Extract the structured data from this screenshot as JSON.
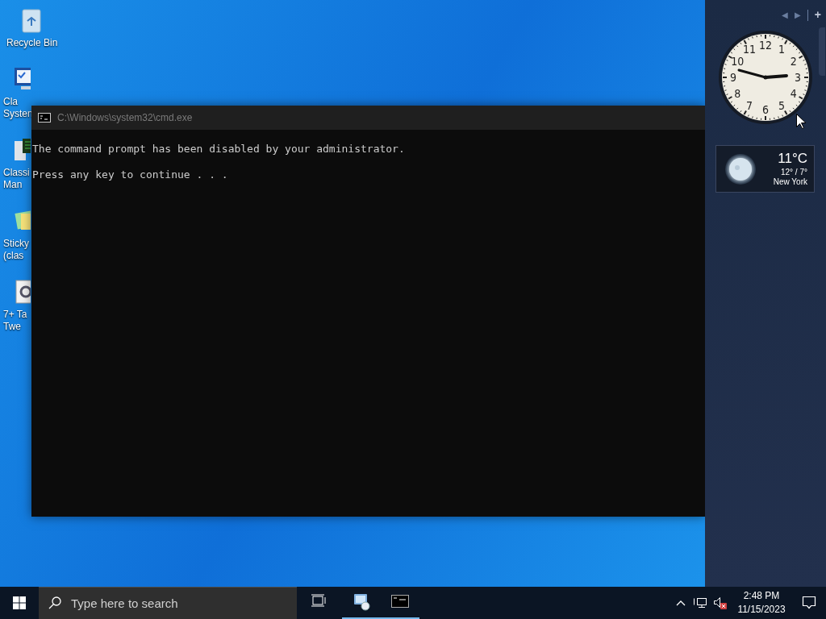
{
  "desktop_icons": [
    {
      "kind": "bin",
      "lines": [
        "Recycle Bin"
      ]
    },
    {
      "kind": "monitor",
      "lines": [
        "Cla",
        "Systen"
      ]
    },
    {
      "kind": "computer",
      "lines": [
        "Classi",
        "Man"
      ]
    },
    {
      "kind": "notes",
      "lines": [
        "Sticky",
        "(clas"
      ]
    },
    {
      "kind": "tweaker",
      "lines": [
        "7+ Ta",
        "Twe"
      ]
    }
  ],
  "console": {
    "title": "C:\\Windows\\system32\\cmd.exe",
    "lines": [
      "The command prompt has been disabled by your administrator.",
      "Press any key to continue . . ."
    ]
  },
  "gadgets": {
    "previous_label": "◀",
    "next_label": "▶",
    "add_label": "+",
    "clock": {
      "numerals": [
        "12",
        "11",
        "1",
        "10",
        "2",
        "9",
        "3",
        "8",
        "4",
        "7",
        "5",
        "6"
      ]
    },
    "weather": {
      "temperature": "11°C",
      "range": "12° / 7°",
      "city": "New York"
    }
  },
  "taskbar": {
    "search": {
      "placeholder": "Type here to search"
    },
    "apps": [
      {
        "kind": "task-view",
        "running": false
      },
      {
        "kind": "control-panel",
        "running": true
      },
      {
        "kind": "console",
        "running": true
      }
    ],
    "tray": {
      "volume_muted": true,
      "time": "2:48 PM",
      "date": "11/15/2023"
    }
  }
}
